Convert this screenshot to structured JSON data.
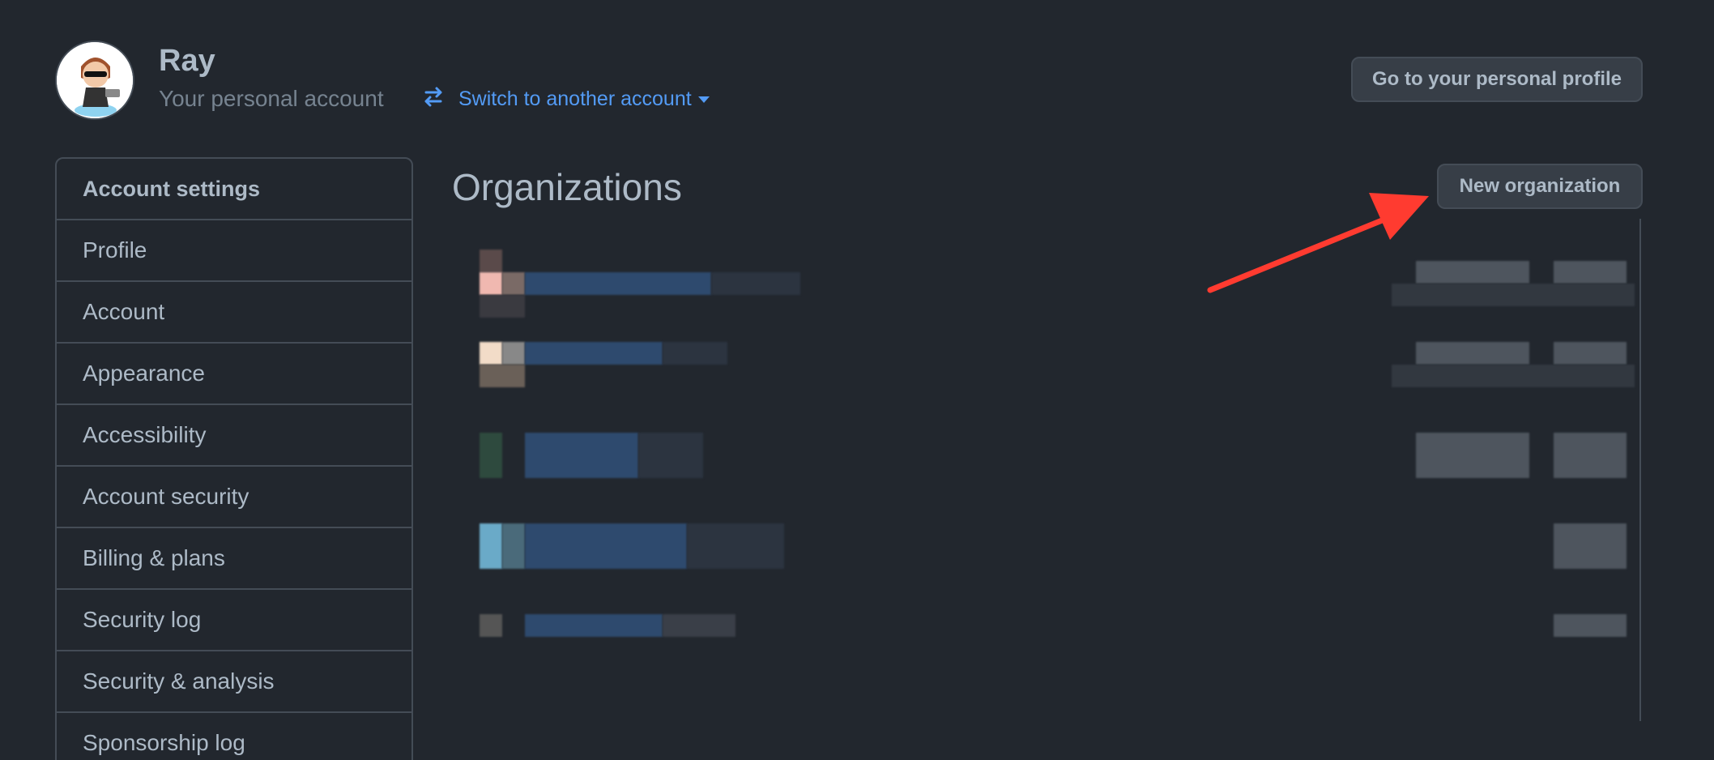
{
  "header": {
    "user_name": "Ray",
    "user_subtitle": "Your personal account",
    "switch_account_label": "Switch to another account",
    "profile_button_label": "Go to your personal profile"
  },
  "sidebar": {
    "items": [
      {
        "label": "Account settings"
      },
      {
        "label": "Profile"
      },
      {
        "label": "Account"
      },
      {
        "label": "Appearance"
      },
      {
        "label": "Accessibility"
      },
      {
        "label": "Account security"
      },
      {
        "label": "Billing & plans"
      },
      {
        "label": "Security log"
      },
      {
        "label": "Security & analysis"
      },
      {
        "label": "Sponsorship log"
      }
    ]
  },
  "main": {
    "title": "Organizations",
    "new_org_button_label": "New organization"
  },
  "colors": {
    "background": "#22272e",
    "border": "#444c56",
    "link": "#539bf5",
    "button_bg": "#373e47",
    "annotation_arrow": "#ff3b30"
  },
  "icons": {
    "switch": "arrow-switch-icon",
    "caret": "caret-down-icon",
    "annotation": "red-arrow-annotation"
  }
}
